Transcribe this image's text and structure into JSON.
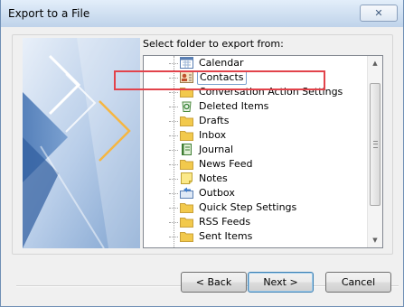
{
  "window": {
    "title": "Export to a File",
    "close_glyph": "✕"
  },
  "prompt": "Select folder to export from:",
  "tree": {
    "items": [
      {
        "label": "Calendar",
        "icon": "calendar-icon",
        "selected": false
      },
      {
        "label": "Contacts",
        "icon": "contacts-icon",
        "selected": true
      },
      {
        "label": "Conversation Action Settings",
        "icon": "folder-icon",
        "selected": false
      },
      {
        "label": "Deleted Items",
        "icon": "recycle-folder-icon",
        "selected": false
      },
      {
        "label": "Drafts",
        "icon": "folder-icon",
        "selected": false
      },
      {
        "label": "Inbox",
        "icon": "folder-icon",
        "selected": false
      },
      {
        "label": "Journal",
        "icon": "journal-icon",
        "selected": false
      },
      {
        "label": "News Feed",
        "icon": "folder-icon",
        "selected": false
      },
      {
        "label": "Notes",
        "icon": "notes-icon",
        "selected": false
      },
      {
        "label": "Outbox",
        "icon": "outbox-icon",
        "selected": false
      },
      {
        "label": "Quick Step Settings",
        "icon": "folder-icon",
        "selected": false
      },
      {
        "label": "RSS Feeds",
        "icon": "folder-icon",
        "selected": false
      },
      {
        "label": "Sent Items",
        "icon": "folder-icon",
        "selected": false
      }
    ]
  },
  "buttons": {
    "back": "< Back",
    "next": "Next >",
    "cancel": "Cancel"
  },
  "colors": {
    "highlight": "#e2434b",
    "folder": "#f2c94c",
    "titlebar": "#cfdff1"
  }
}
